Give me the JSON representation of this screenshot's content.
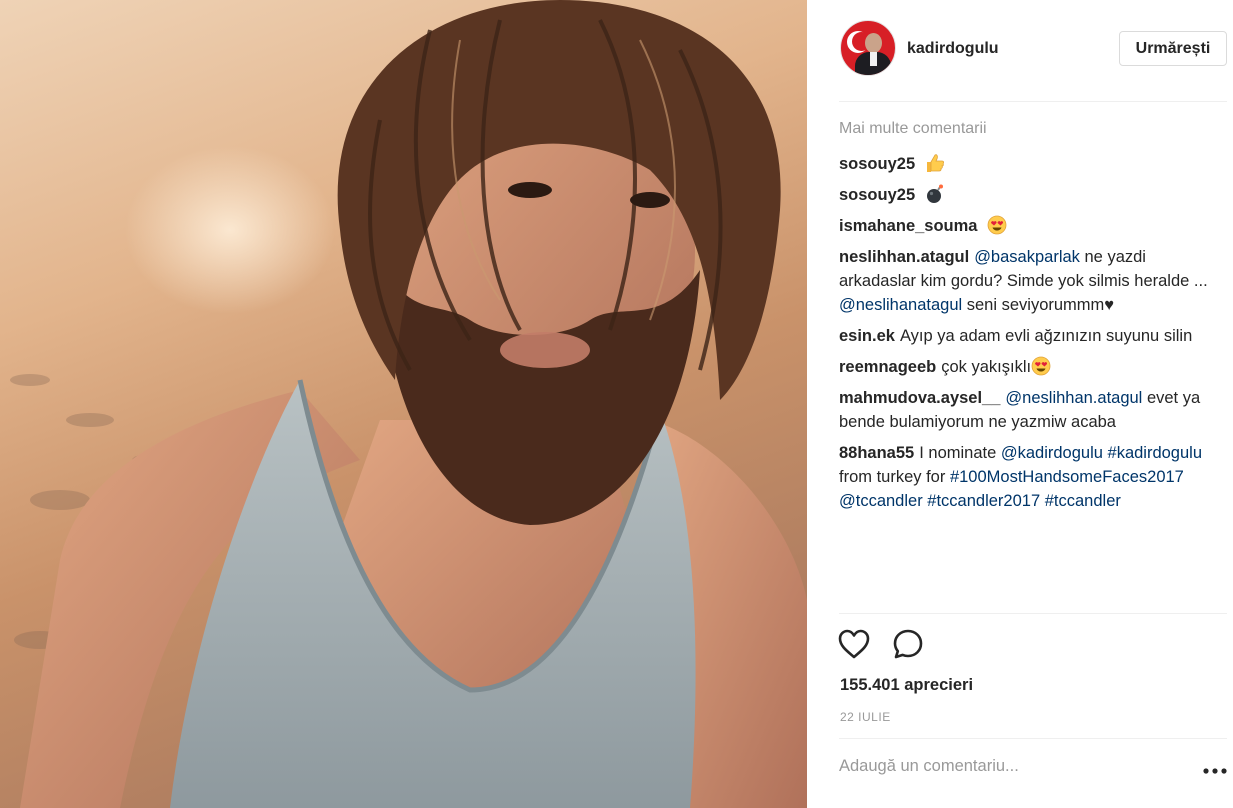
{
  "post": {
    "image_alt": "",
    "author": "kadirdogulu",
    "follow_label": "Urmărești",
    "more_comments_label": "Mai multe comentarii",
    "comments": [
      {
        "user": "sosouy25",
        "emoji": "thumbs-up"
      },
      {
        "user": "sosouy25",
        "emoji": "bomb"
      },
      {
        "user": "ismahane_souma",
        "emoji": "heart-eyes"
      },
      {
        "user": "neslihhan.atagul",
        "mention1": "@basakparlak",
        "text1": " ne yazdi arkadaslar kim gordu? Simde yok silmis heralde ... ",
        "mention2": "@neslihanatagul",
        "text2": " seni seviyorummm♥"
      },
      {
        "user": "esin.ek",
        "text": "Ayıp ya adam evli ağzınızın suyunu silin"
      },
      {
        "user": "reemnageeb",
        "text": "çok yakışıklı",
        "emoji": "heart-eyes"
      },
      {
        "user": "mahmudova.aysel__",
        "mention1": "@neslihhan.atagul",
        "text1": " evet ya bende bulamiyorum ne yazmiw acaba"
      },
      {
        "user": "88hana55",
        "text1": "I nominate ",
        "mention1": "@kadirdogulu",
        "mention2": "#kadirdogulu",
        "text2": " from turkey for ",
        "mention3": "#100MostHandsomeFaces2017",
        "mention4": "@tccandler",
        "mention5": "#tccandler2017",
        "mention6": "#tccandler"
      }
    ],
    "likes": "155.401 aprecieri",
    "date": "22 IULIE",
    "add_comment_placeholder": "Adaugă un comentariu...",
    "icons": [
      "heart-icon",
      "comment-icon",
      "more-options-icon"
    ]
  }
}
